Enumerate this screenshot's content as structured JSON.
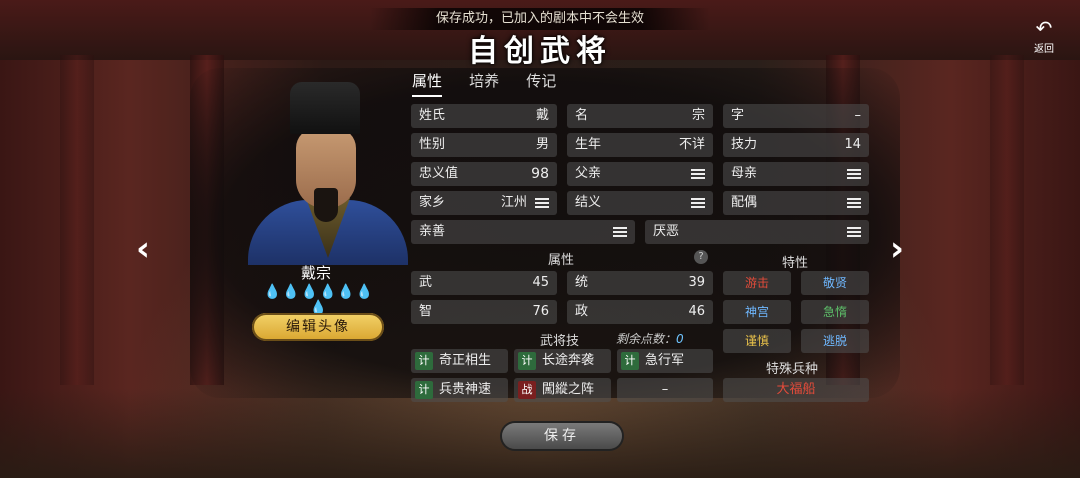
{
  "toast": "保存成功，已加入的剧本中不会生效",
  "title": "自创武将",
  "back_label": "返回",
  "general": {
    "name": "戴宗",
    "drops": "💧💧💧💧💧💧💧",
    "edit_avatar": "编辑头像"
  },
  "tabs": [
    "属性",
    "培养",
    "传记"
  ],
  "info": {
    "surname_k": "姓氏",
    "surname_v": "戴",
    "given_k": "名",
    "given_v": "宗",
    "courtesy_k": "字",
    "courtesy_v": "–",
    "gender_k": "性别",
    "gender_v": "男",
    "birth_k": "生年",
    "birth_v": "不详",
    "skill_k": "技力",
    "skill_v": "14",
    "loyalty_k": "忠义值",
    "loyalty_v": "98",
    "father_k": "父亲",
    "mother_k": "母亲",
    "home_k": "家乡",
    "home_v": "江州",
    "sworn_k": "结义",
    "spouse_k": "配偶",
    "like_k": "亲善",
    "hate_k": "厌恶"
  },
  "attrs": {
    "header": "属性",
    "help": "?",
    "wu_k": "武",
    "wu_v": "45",
    "tong_k": "统",
    "tong_v": "39",
    "zhi_k": "智",
    "zhi_v": "76",
    "zheng_k": "政",
    "zheng_v": "46"
  },
  "skills": {
    "header": "武将技",
    "remain_label": "剩余点数：",
    "remain_value": "0",
    "ji": "计",
    "zhan": "战",
    "s1": "奇正相生",
    "s2": "长途奔袭",
    "s3": "急行军",
    "s4": "兵贵神速",
    "s5": "闖縱之阵",
    "s6": "–"
  },
  "traits": {
    "header": "特性",
    "t1": "游击",
    "t2": "敬贤",
    "t3": "神宫",
    "t4": "急惰",
    "t5": "谨慎",
    "t6": "逃脱",
    "colors": {
      "t1": "#e34b3a",
      "t2": "#6fb8ff",
      "t3": "#6fb8ff",
      "t4": "#5ec06a",
      "t5": "#e8c14a",
      "t6": "#6fb8ff"
    }
  },
  "special": {
    "header": "特殊兵种",
    "value": "大福船",
    "color": "#e34b3a"
  },
  "save": "保存"
}
